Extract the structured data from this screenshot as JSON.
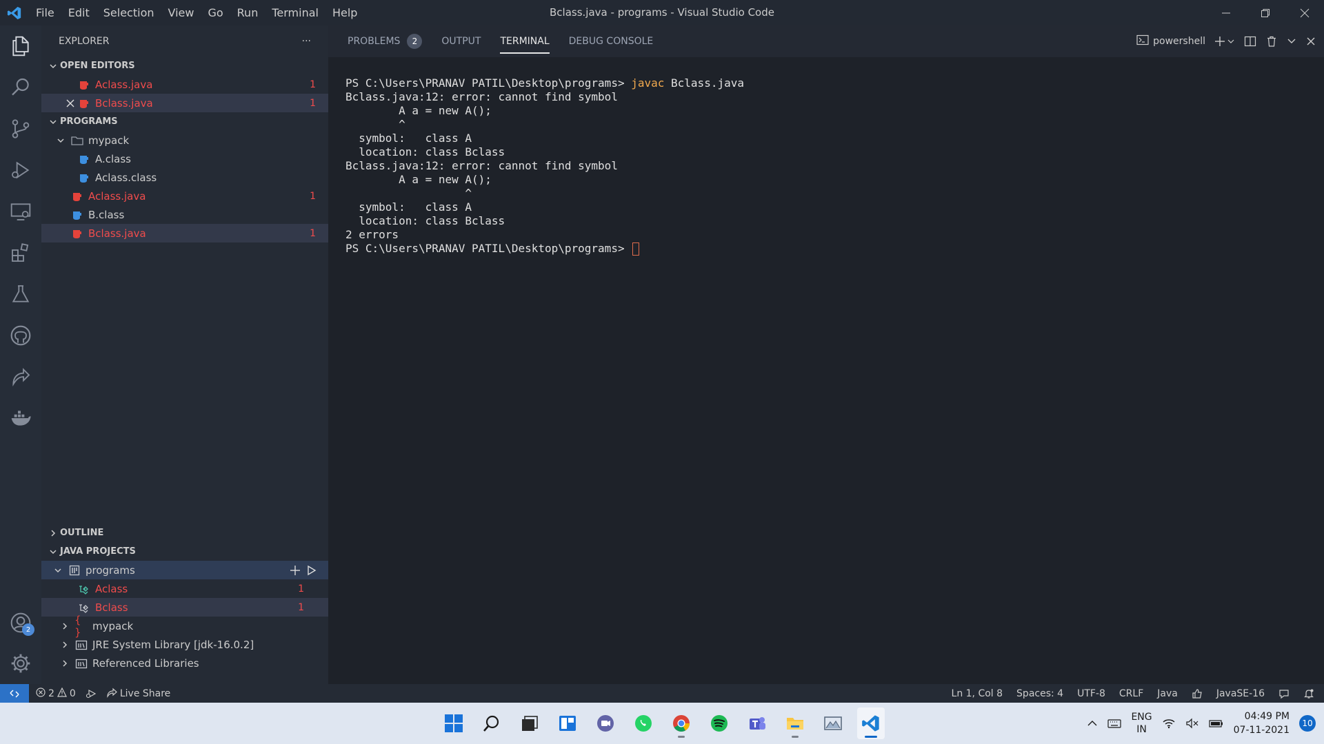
{
  "window": {
    "title": "Bclass.java - programs - Visual Studio Code",
    "menu": [
      "File",
      "Edit",
      "Selection",
      "View",
      "Go",
      "Run",
      "Terminal",
      "Help"
    ]
  },
  "activity": {
    "account_badge": "2"
  },
  "explorer": {
    "title": "EXPLORER",
    "more": "···",
    "open_editors": {
      "label": "OPEN EDITORS",
      "items": [
        {
          "name": "Aclass.java",
          "count": "1"
        },
        {
          "name": "Bclass.java",
          "count": "1"
        }
      ]
    },
    "programs": {
      "label": "PROGRAMS",
      "folder": "mypack",
      "items": [
        {
          "name": "A.class"
        },
        {
          "name": "Aclass.class"
        },
        {
          "name": "Aclass.java",
          "count": "1"
        },
        {
          "name": "B.class"
        },
        {
          "name": "Bclass.java",
          "count": "1"
        }
      ]
    },
    "outline": {
      "label": "OUTLINE"
    },
    "java_projects": {
      "label": "JAVA PROJECTS",
      "project": "programs",
      "items": [
        {
          "name": "Aclass",
          "count": "1"
        },
        {
          "name": "Bclass",
          "count": "1"
        },
        {
          "name": "mypack"
        },
        {
          "name": "JRE System Library [jdk-16.0.2]"
        },
        {
          "name": "Referenced Libraries"
        }
      ]
    }
  },
  "panel": {
    "tabs": [
      "PROBLEMS",
      "OUTPUT",
      "TERMINAL",
      "DEBUG CONSOLE"
    ],
    "problems_badge": "2",
    "active_tab": "TERMINAL",
    "shell": "powershell"
  },
  "terminal": {
    "prompt": "PS C:\\Users\\PRANAV PATIL\\Desktop\\programs> ",
    "command_keyword": "javac",
    "command_args": " Bclass.java",
    "lines": [
      "Bclass.java:12: error: cannot find symbol",
      "        A a = new A();",
      "        ^",
      "  symbol:   class A",
      "  location: class Bclass",
      "Bclass.java:12: error: cannot find symbol",
      "        A a = new A();",
      "                  ^",
      "  symbol:   class A",
      "  location: class Bclass",
      "2 errors"
    ]
  },
  "statusbar": {
    "errors": "2",
    "warnings": "0",
    "live_share": "Live Share",
    "position": "Ln 1, Col 8",
    "spaces": "Spaces: 4",
    "encoding": "UTF-8",
    "eol": "CRLF",
    "language": "Java",
    "runtime": "JavaSE-16"
  },
  "taskbar": {
    "lang_top": "ENG",
    "lang_bottom": "IN",
    "time": "04:49 PM",
    "date": "07-11-2021",
    "notifications": "10"
  },
  "colors": {
    "error": "#f14c4c",
    "accent": "#2c72c7",
    "terminal_cmd": "#f1a94e"
  }
}
